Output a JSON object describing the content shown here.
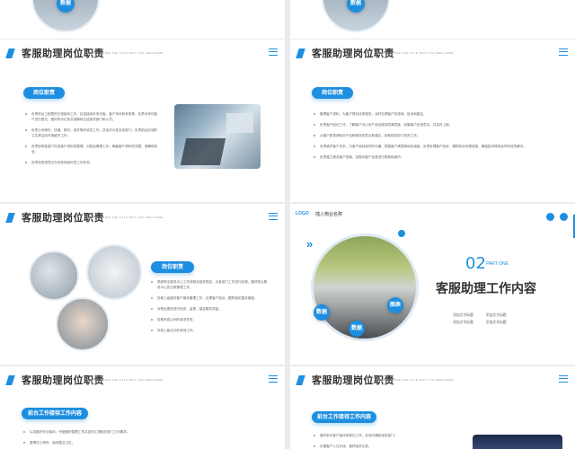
{
  "header": {
    "title": "客服助理岗位职责",
    "subtitle": "PLEASE ENTER THE TITLE TEXT YOU NEED HERE"
  },
  "slide_r0_left": {
    "badge": "数据"
  },
  "slide_r0_right": {
    "badge": "数据"
  },
  "slide_r1_left": {
    "pill": "岗位职责",
    "bullets": [
      "负责前台工程里的日常接待工作，包括接待外来访客、客户来访和来电等，负责对来访客户进行登记，做好来访记录并准确转达给相关部门和人员。",
      "负责公司邮件、快递、报刊、信件等的收发工作，并及时分发至各部门；负责前台区域的卫生清洁及环境维护工作。",
      "负责协助各部门完成客户资料的整理、归档及管理工作，确保客户资料的完整、准确和安全。",
      "负责完成领导交办的其他临时性工作任务。"
    ]
  },
  "slide_r1_right": {
    "pill": "岗位职责",
    "bullets": [
      "管理客户资料，为客户提供优质服务，及时处理客户的咨询、投诉和建议。",
      "负责客户回访工作，了解客户对公司产品及服务的满意度，收集客户反馈意见，并及时上报。",
      "从客户那里获取对产品和服务的意见和建议，协助相关部门改进工作。",
      "负责维护客户关系，与客户保持良好的沟通，提高客户满意度和忠诚度；负责处理客户投诉，跟踪投诉处理进度，确保投诉得到及时有效的解决。",
      "负责建立健全客户档案，定期对客户信息进行更新和维护。"
    ]
  },
  "slide_r2_left": {
    "pill": "岗位职责",
    "bullets": [
      "熟悉物业服务中心工作流程及相关规定，对各部门工作进行协调，做好物业服务中心的日常管理工作。",
      "协助上级做好客户服务管理工作，处理客户投诉，跟踪落实整改措施。",
      "对物业服务进行检查、监督，保证服务质量。",
      "协助完成公司的各项任务。",
      "完成上级交办的其他工作。"
    ]
  },
  "slide_r2_right": {
    "logo": "LOGO",
    "company": "插入物业名称",
    "number": "02",
    "part": "PART ONE",
    "heading": "客服助理工作内容",
    "items": [
      "添加文字标题",
      "添加文字标题",
      "添加文字标题",
      "添加文字标题"
    ],
    "badge1": "数据",
    "badge2": "图表",
    "badge3": "数据"
  },
  "slide_r3_left": {
    "pill": "前台工作接待工作内容",
    "bullets": [
      "认真做好毕业接待，仔细做好整理工作并及时汇报相关部门工作要求。",
      "整理办公场所，保持整洁卫生。"
    ]
  },
  "slide_r3_right": {
    "pill": "前台工作接待工作内容",
    "bullets": [
      "做好来访客户接待的登记工作，并及时通知相关部门。",
      "办理客户入住手续，做好相关记录。"
    ]
  },
  "colors": {
    "accent": "#1e8fe0",
    "title": "#333333",
    "text": "#666666",
    "page_bg": "#e9ebef"
  }
}
